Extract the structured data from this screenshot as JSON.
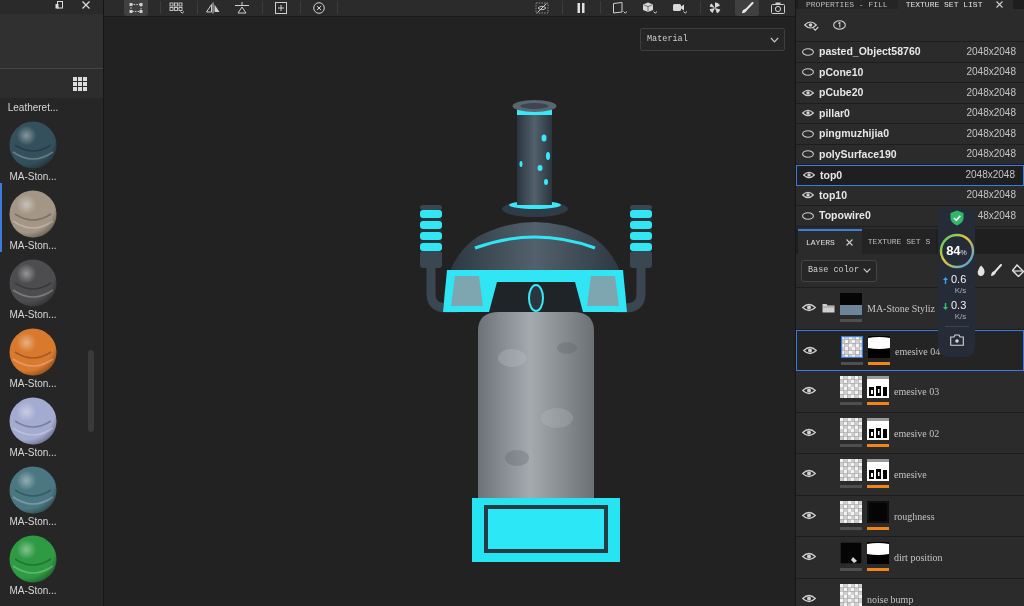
{
  "left_panel": {
    "materials": [
      {
        "label": "Leatheret...",
        "selected": false
      },
      {
        "label": "MA-Ston...",
        "color": "#34505c",
        "selected": false
      },
      {
        "label": "MA-Ston...",
        "color": "#a39686",
        "selected": true
      },
      {
        "label": "MA-Ston...",
        "color": "#4d4d4f",
        "selected": false
      },
      {
        "label": "MA-Ston...",
        "color": "#d9792e",
        "selected": false
      },
      {
        "label": "MA-Ston...",
        "color": "#a3abd0",
        "selected": false
      },
      {
        "label": "MA-Ston...",
        "color": "#4b7782",
        "selected": false
      },
      {
        "label": "MA-Ston...",
        "color": "#2f9a44",
        "selected": false
      }
    ]
  },
  "viewport": {
    "toolbar": {
      "left": [
        {
          "selected": true
        },
        {
          "selected": false
        },
        {
          "selected": false
        },
        {
          "selected": false
        },
        {
          "selected": false
        },
        {
          "selected": false
        }
      ],
      "right": [
        {
          "selected": false
        },
        {
          "selected": false
        },
        {
          "selected": false
        },
        {
          "selected": false
        },
        {
          "selected": false
        },
        {
          "selected": false
        },
        {
          "selected": true
        },
        {
          "selected": false
        }
      ]
    },
    "view_mode": "Material"
  },
  "right_panel": {
    "tabs": [
      {
        "label": "PROPERTIES - FILL",
        "selected": false
      },
      {
        "label": "TEXTURE SET LIST",
        "selected": true
      }
    ],
    "texture_sets": [
      {
        "name": "pasted_Object58760",
        "resolution": "2048x2048",
        "visible": false,
        "selected": false
      },
      {
        "name": "pCone10",
        "resolution": "2048x2048",
        "visible": false,
        "selected": false
      },
      {
        "name": "pCube20",
        "resolution": "2048x2048",
        "visible": true,
        "selected": false
      },
      {
        "name": "pillar0",
        "resolution": "2048x2048",
        "visible": true,
        "selected": false
      },
      {
        "name": "pingmuzhijia0",
        "resolution": "2048x2048",
        "visible": false,
        "selected": false
      },
      {
        "name": "polySurface190",
        "resolution": "2048x2048",
        "visible": false,
        "selected": false
      },
      {
        "name": "top0",
        "resolution": "2048x2048",
        "visible": true,
        "selected": true
      },
      {
        "name": "top10",
        "resolution": "2048x2048",
        "visible": true,
        "selected": false
      },
      {
        "name": "Topowire0",
        "resolution": "48x2048",
        "visible": false,
        "selected": false
      }
    ],
    "layer_tabs": [
      {
        "label": "LAYERS",
        "selected": true
      },
      {
        "label": "TEXTURE SET S",
        "selected": false
      }
    ],
    "channel": "Base color",
    "layers": [
      {
        "name": "MA-Stone Styliz",
        "kind": "folder",
        "selected": false
      },
      {
        "name": "emesive 04",
        "kind": "layer",
        "mask": {
          "kind": "split"
        },
        "selected": true
      },
      {
        "name": "emesive 03",
        "kind": "layer",
        "mask": {
          "kind": "pattern"
        },
        "selected": false
      },
      {
        "name": "emesive 02",
        "kind": "layer",
        "mask": {
          "kind": "pattern"
        },
        "selected": false
      },
      {
        "name": "emesive",
        "kind": "layer",
        "mask": {
          "kind": "pattern"
        },
        "selected": false
      },
      {
        "name": "roughness",
        "kind": "layer",
        "mask": {
          "kind": "dark"
        },
        "selected": false
      },
      {
        "name": "dirt position",
        "kind": "fill",
        "mask": {
          "kind": "split"
        },
        "selected": false
      },
      {
        "name": "noise bump",
        "kind": "layer",
        "selected": false
      }
    ]
  },
  "monitor": {
    "percent": "84",
    "percent_unit": "%",
    "upload": "0.6",
    "upload_unit": "K/s",
    "download": "0.3",
    "download_unit": "K/s"
  }
}
